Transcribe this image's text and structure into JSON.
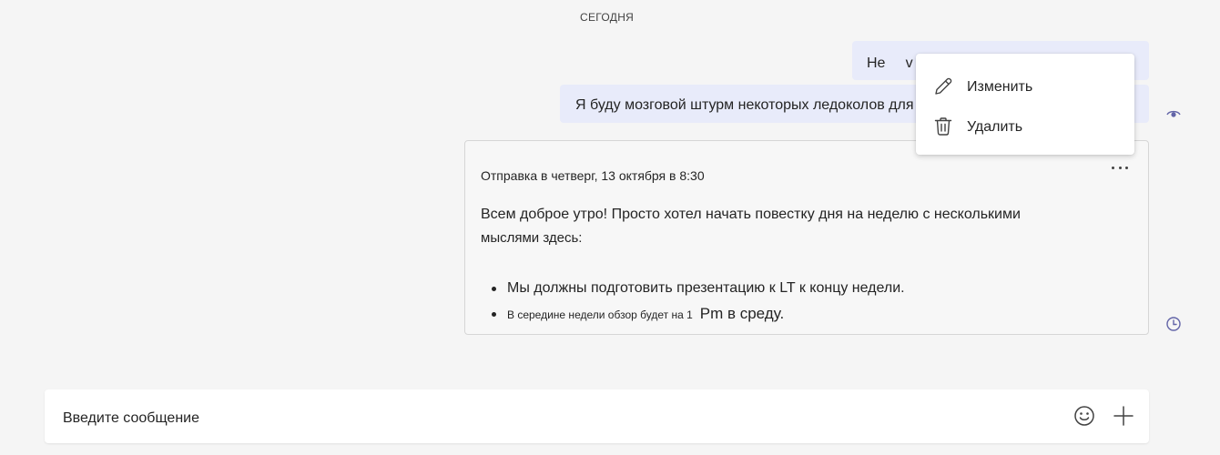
{
  "chat": {
    "date_divider": "СЕГОДНЯ",
    "messages": [
      {
        "text": "Не     v"
      },
      {
        "text": "Я буду мозговой штурм некоторых ледоколов для нашей команды"
      }
    ],
    "scheduled": {
      "header": "Отправка в четверг, 13 октября в 8:30",
      "body_line1": "Всем доброе утро! Просто хотел начать повестку дня на неделю с несколькими",
      "body_line2": "мыслями здесь:",
      "bullet1": "Мы должны подготовить презентацию к LT к концу недели.",
      "bullet2_small": "В середине недели обзор будет на 1",
      "bullet2_large": "Pm в среду."
    }
  },
  "context_menu": {
    "edit_label": "Изменить",
    "delete_label": "Удалить"
  },
  "composer": {
    "placeholder": "Введите сообщение"
  },
  "icons": {
    "more": "more-horizontal-icon",
    "edit": "pencil-icon",
    "delete": "trash-icon",
    "seen": "eye-icon",
    "scheduled": "clock-icon",
    "emoji": "emoji-icon",
    "add": "plus-icon"
  },
  "colors": {
    "background": "#f5f5f5",
    "bubble": "#e8ebfa",
    "accent": "#6264a7",
    "card_border": "#d6d6d6"
  }
}
